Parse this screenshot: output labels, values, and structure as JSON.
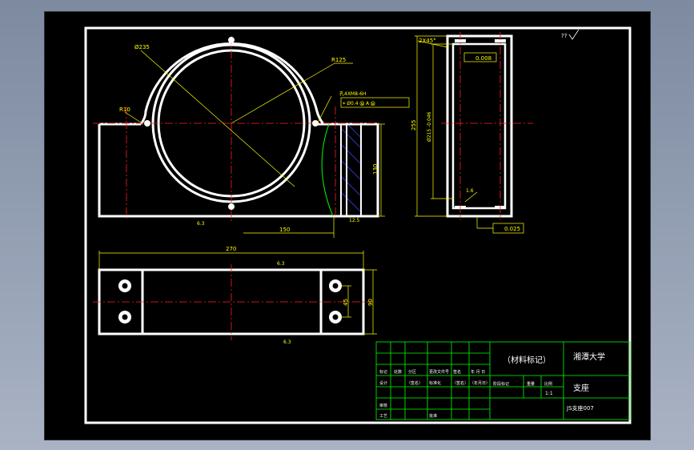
{
  "drawing": {
    "colors": {
      "background": "#000000",
      "outline": "#ffffff",
      "centerline": "#ff2020",
      "dimension": "#ffff00",
      "hatch": "#4040ff",
      "break_line": "#00ff00",
      "title_block": "#00ff00"
    },
    "corner_mark": "??",
    "front_view": {
      "dia_outer": "Ø235",
      "radius_top": "R125",
      "radius_fillet": "R10",
      "hole_note": "孔4XM8-6H",
      "position_tol": "⌖ Ø0.4 Ⓜ A Ⓜ",
      "height_dim": "130",
      "offset_dim": "150",
      "roughness_bottom": "6.3",
      "roughness_right": "12.5"
    },
    "side_view": {
      "chamfer": "2X45°",
      "parallel_tol": "0.008",
      "height_dim": "255",
      "bore_dim": "Ø215 -0.046",
      "roughness": "1.6",
      "flatness_tol": "0.025"
    },
    "top_view": {
      "length_dim": "270",
      "hole_pitch": "45",
      "width_dim": "90",
      "roughness_top": "6.3",
      "roughness_bottom": "6.3"
    },
    "title_block": {
      "material_mark": "（材料标记）",
      "university": "湘潭大学",
      "part_name": "支座",
      "drawing_no": "JS支座007",
      "scale": "1:1",
      "row_marks": [
        "标记",
        "处数",
        "分区",
        "更改文件号",
        "签名",
        "年 月 日"
      ],
      "row_design": [
        "设计",
        "（签名）",
        "标准化",
        "（签名）",
        "（年月日）"
      ],
      "row_review": "审核",
      "row_process": "工艺",
      "row_approve": "批准",
      "stage_mark": "阶段标记",
      "weight": "重量",
      "ratio": "比例"
    }
  }
}
